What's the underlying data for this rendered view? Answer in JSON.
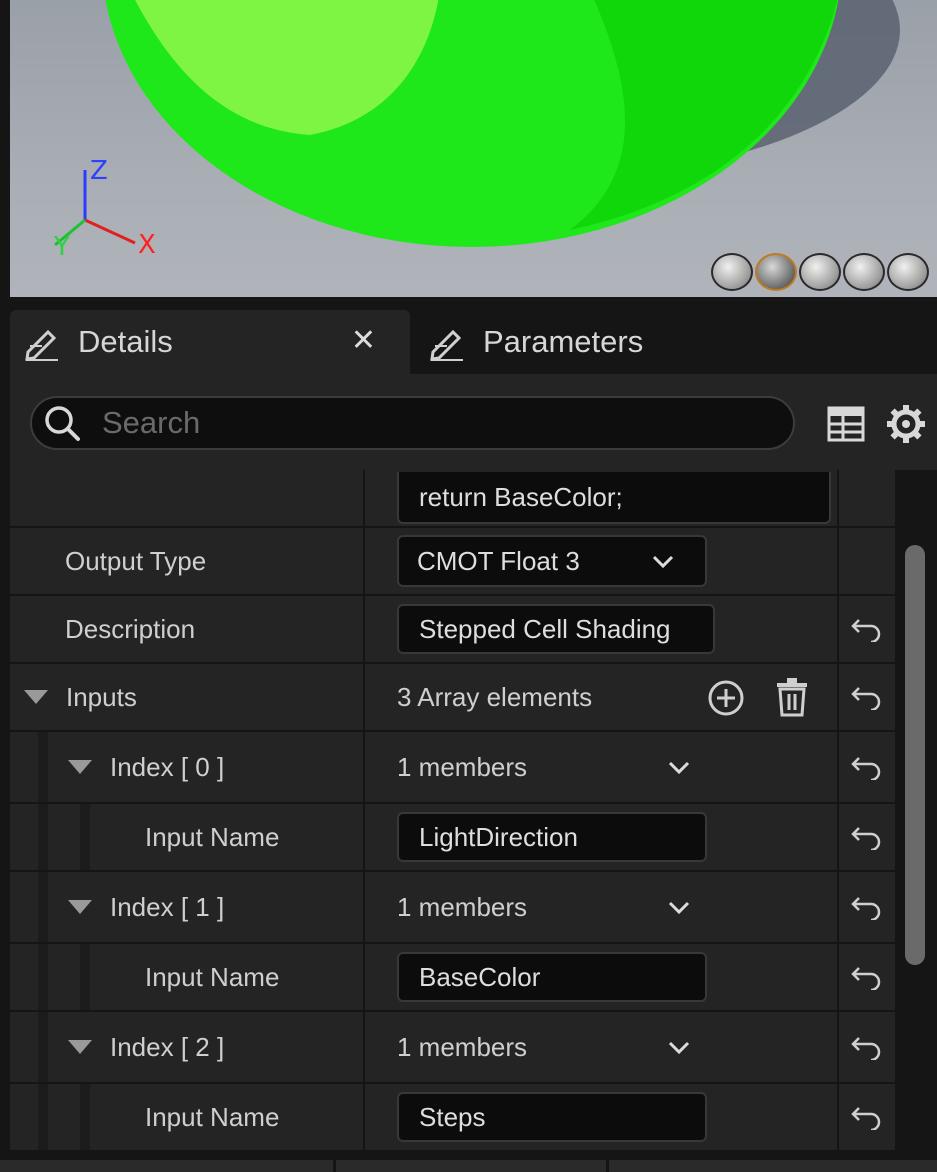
{
  "viewport": {
    "axis": {
      "z": "Z",
      "y": "Y",
      "x": "X"
    },
    "preview_buttons": [
      "cylinder-preview-icon",
      "sphere-preview-icon",
      "plane-preview-icon",
      "cube-preview-icon",
      "mesh-preview-icon"
    ],
    "active_preview": "sphere-preview-icon",
    "sphere_color": "#33ff22"
  },
  "tabs": [
    {
      "label": "Details",
      "icon": "edit-icon",
      "closable": true
    },
    {
      "label": "Parameters",
      "icon": "edit-icon",
      "closable": false
    }
  ],
  "search": {
    "placeholder": "Search"
  },
  "toolbar": {
    "table_icon": "table-view-icon",
    "settings_icon": "gear-icon"
  },
  "details": {
    "code_value": "return BaseColor;",
    "output_type": {
      "label": "Output Type",
      "value": "CMOT Float 3"
    },
    "description": {
      "label": "Description",
      "value": "Stepped Cell Shading"
    },
    "inputs": {
      "label": "Inputs",
      "summary": "3 Array elements",
      "items": [
        {
          "index_label": "Index [ 0 ]",
          "members": "1 members",
          "input_label": "Input Name",
          "input_value": "LightDirection"
        },
        {
          "index_label": "Index [ 1 ]",
          "members": "1 members",
          "input_label": "Input Name",
          "input_value": "BaseColor"
        },
        {
          "index_label": "Index [ 2 ]",
          "members": "1 members",
          "input_label": "Input Name",
          "input_value": "Steps"
        }
      ]
    }
  }
}
